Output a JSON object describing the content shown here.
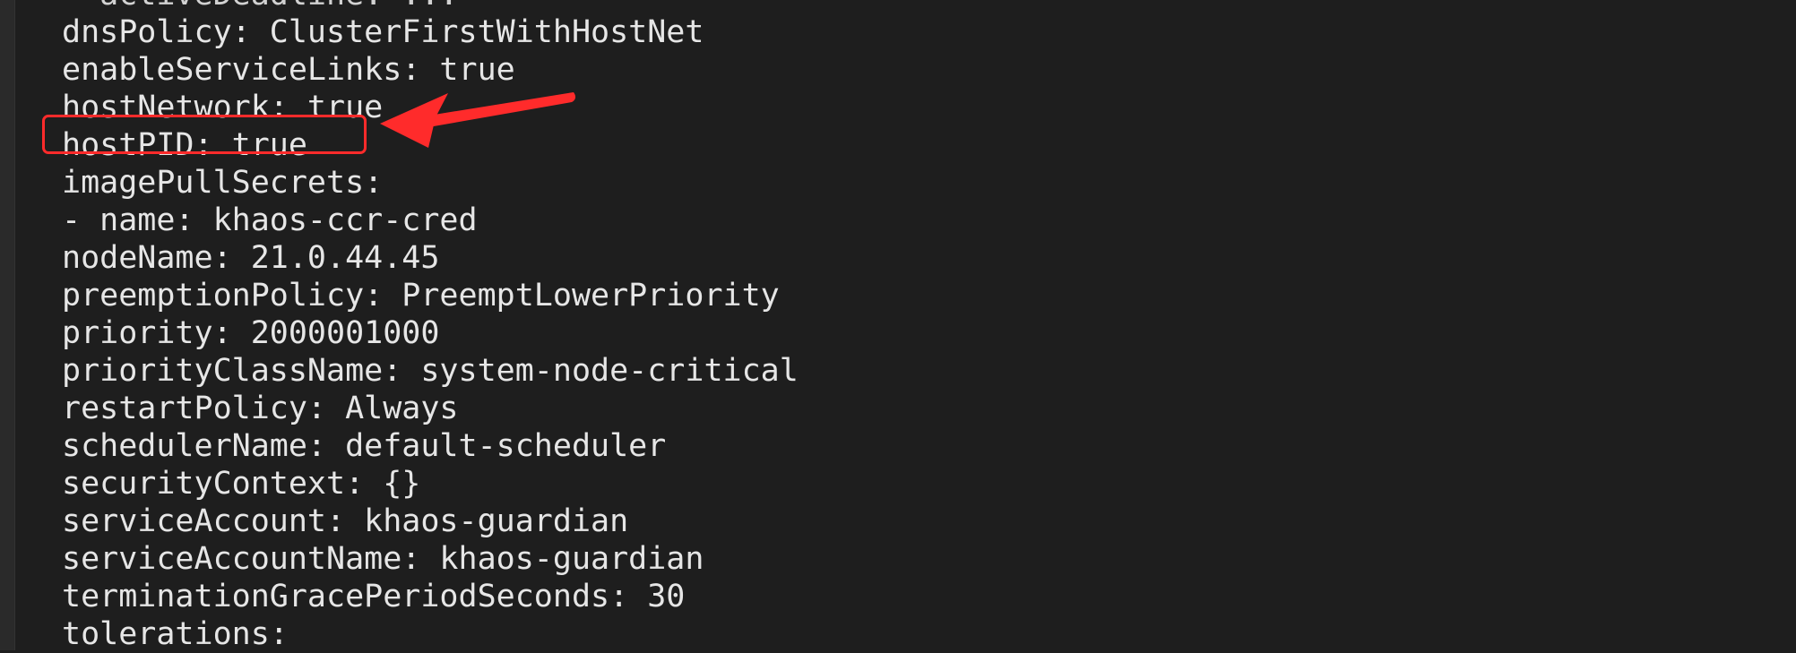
{
  "terminal": {
    "lines": [
      "  activeDeadline: ...",
      "dnsPolicy: ClusterFirstWithHostNet",
      "enableServiceLinks: true",
      "hostNetwork: true",
      "hostPID: true",
      "imagePullSecrets:",
      "- name: khaos-ccr-cred",
      "nodeName: 21.0.44.45",
      "preemptionPolicy: PreemptLowerPriority",
      "priority: 2000001000",
      "priorityClassName: system-node-critical",
      "restartPolicy: Always",
      "schedulerName: default-scheduler",
      "securityContext: {}",
      "serviceAccount: khaos-guardian",
      "serviceAccountName: khaos-guardian",
      "terminationGracePeriodSeconds: 30",
      "tolerations:"
    ]
  },
  "annotation": {
    "color": "#ff2b2b",
    "target_line_index": 4
  },
  "colors": {
    "background": "#1e1e1e",
    "text": "#e6e6e6"
  }
}
